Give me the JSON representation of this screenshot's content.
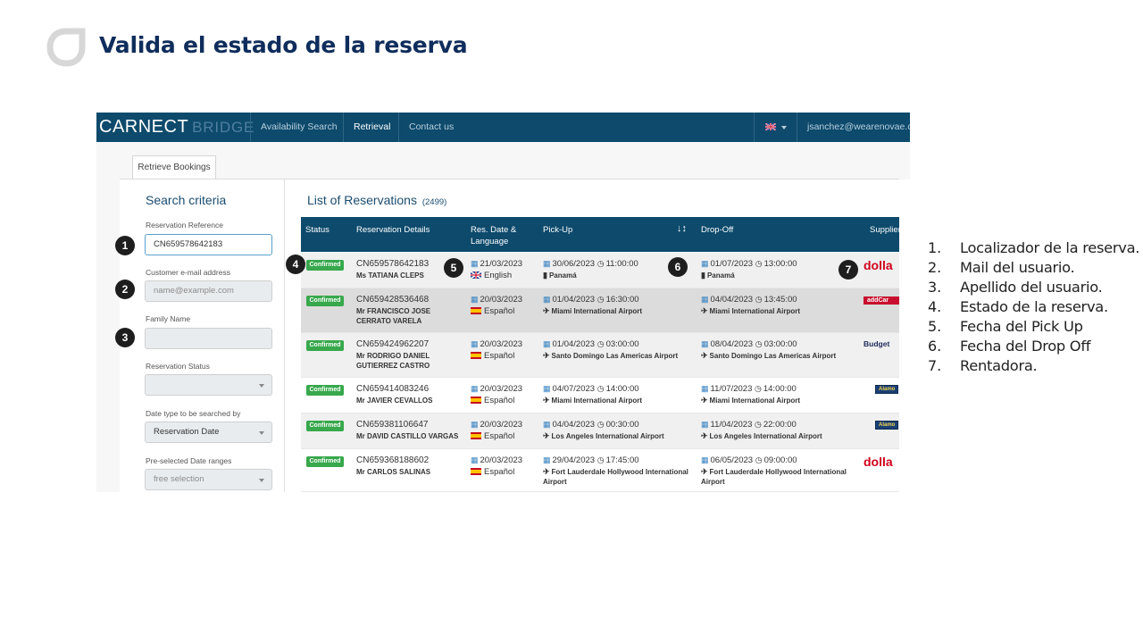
{
  "slide": {
    "title": "Valida el estado de la reserva"
  },
  "app": {
    "brand_main": "CARNECT",
    "brand_sub": "BRIDGE",
    "nav": [
      "Availability Search",
      "Retrieval",
      "Contact us"
    ],
    "active_nav": "Retrieval",
    "user_email": "jsanchez@wearenovae.com"
  },
  "tab": "Retrieve Bookings",
  "search": {
    "title": "Search criteria",
    "reference_label": "Reservation Reference",
    "reference_value": "CN659578642183",
    "email_label": "Customer e-mail address",
    "email_placeholder": "name@example.com",
    "family_label": "Family Name",
    "family_value": "",
    "status_label": "Reservation Status",
    "status_value": "",
    "date_type_label": "Date type to be searched by",
    "date_type_value": "Reservation Date",
    "ranges_label": "Pre-selected Date ranges",
    "ranges_value": "free selection"
  },
  "list": {
    "title": "List of Reservations",
    "count": "(2499)",
    "columns": [
      "Status",
      "Reservation Details",
      "Res. Date &",
      "Language",
      "Pick-Up",
      "Drop-Off",
      "Supplier"
    ],
    "sort_icon": "sort-desc-icon",
    "rows": [
      {
        "status": "Confirmed",
        "ref": "CN659578642183",
        "name": "Ms TATIANA CLEPS",
        "res_date": "21/03/2023",
        "lang": "English",
        "flag": "uk",
        "pick_date": "30/06/2023",
        "pick_time": "11:00:00",
        "pick_loc": "Panamá",
        "pick_loc_icon": "building-icon",
        "drop_date": "01/07/2023",
        "drop_time": "13:00:00",
        "drop_loc": "Panamá",
        "drop_loc_icon": "building-icon",
        "supplier": "dolla",
        "supplier_style": "dollar"
      },
      {
        "status": "Confirmed",
        "ref": "CN659428536468",
        "name": "Mr FRANCISCO JOSE CERRATO VARELA",
        "res_date": "20/03/2023",
        "lang": "Español",
        "flag": "es",
        "pick_date": "01/04/2023",
        "pick_time": "16:30:00",
        "pick_loc": "Miami International Airport",
        "pick_loc_icon": "airplane-icon",
        "drop_date": "04/04/2023",
        "drop_time": "13:45:00",
        "drop_loc": "Miami International Airport",
        "drop_loc_icon": "airplane-icon",
        "supplier": "addCar",
        "supplier_style": "addcar"
      },
      {
        "status": "Confirmed",
        "ref": "CN659424962207",
        "name": "Mr RODRIGO DANIEL GUTIERREZ CASTRO",
        "res_date": "20/03/2023",
        "lang": "Español",
        "flag": "es",
        "pick_date": "01/04/2023",
        "pick_time": "03:00:00",
        "pick_loc": "Santo Domingo Las Americas Airport",
        "pick_loc_icon": "airplane-icon",
        "drop_date": "08/04/2023",
        "drop_time": "03:00:00",
        "drop_loc": "Santo Domingo Las Americas Airport",
        "drop_loc_icon": "airplane-icon",
        "supplier": "Budget",
        "supplier_style": "budget"
      },
      {
        "status": "Confirmed",
        "ref": "CN659414083246",
        "name": "Mr JAVIER CEVALLOS",
        "res_date": "20/03/2023",
        "lang": "Español",
        "flag": "es",
        "pick_date": "04/07/2023",
        "pick_time": "14:00:00",
        "pick_loc": "Miami International Airport",
        "pick_loc_icon": "airplane-icon",
        "drop_date": "11/07/2023",
        "drop_time": "14:00:00",
        "drop_loc": "Miami International Airport",
        "drop_loc_icon": "airplane-icon",
        "supplier": "Alamo",
        "supplier_style": "alamo"
      },
      {
        "status": "Confirmed",
        "ref": "CN659381106647",
        "name": "Mr DAVID CASTILLO VARGAS",
        "res_date": "20/03/2023",
        "lang": "Español",
        "flag": "es",
        "pick_date": "04/04/2023",
        "pick_time": "00:30:00",
        "pick_loc": "Los Angeles International Airport",
        "pick_loc_icon": "airplane-icon",
        "drop_date": "11/04/2023",
        "drop_time": "22:00:00",
        "drop_loc": "Los Angeles International Airport",
        "drop_loc_icon": "airplane-icon",
        "supplier": "Alamo",
        "supplier_style": "alamo"
      },
      {
        "status": "Confirmed",
        "ref": "CN659368188602",
        "name": "Mr CARLOS SALINAS",
        "res_date": "20/03/2023",
        "lang": "Español",
        "flag": "es",
        "pick_date": "29/04/2023",
        "pick_time": "17:45:00",
        "pick_loc": "Fort Lauderdale Hollywood International Airport",
        "pick_loc_icon": "airplane-icon",
        "drop_date": "06/05/2023",
        "drop_time": "09:00:00",
        "drop_loc": "Fort Lauderdale Hollywood International Airport",
        "drop_loc_icon": "airplane-icon",
        "supplier": "dolla",
        "supplier_style": "dollar"
      }
    ]
  },
  "markers": [
    "1",
    "2",
    "3",
    "4",
    "5",
    "6",
    "7"
  ],
  "legend": [
    {
      "n": "1.",
      "text": "Localizador de la reserva."
    },
    {
      "n": "2.",
      "text": "Mail del usuario."
    },
    {
      "n": "3.",
      "text": "Apellido del usuario."
    },
    {
      "n": "4.",
      "text": "Estado de la reserva."
    },
    {
      "n": "5.",
      "text": "Fecha del Pick Up"
    },
    {
      "n": "6.",
      "text": "Fecha del Drop Off"
    },
    {
      "n": "7.",
      "text": "Rentadora."
    }
  ],
  "colors": {
    "title": "#0f2d5c",
    "navbar": "#0d4a6c",
    "confirmed": "#37a84c",
    "marker": "#1e1e1e"
  }
}
